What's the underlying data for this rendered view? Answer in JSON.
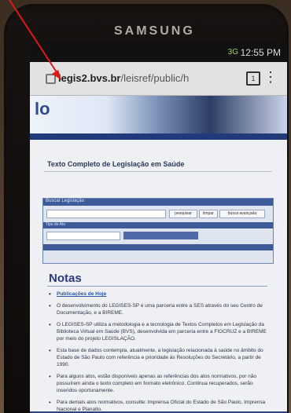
{
  "device": {
    "brand": "SAMSUNG"
  },
  "status_bar": {
    "signal": "3G",
    "time": "12:55 PM"
  },
  "browser": {
    "url_host": "legis2.bvs.br",
    "url_path": "/leisref/public/h",
    "tabs_count": "1"
  },
  "site": {
    "logo_text": "lo",
    "page_title": "Texto Completo de Legislação em Saúde"
  },
  "search": {
    "bar1": "Buscar Legislação",
    "buttons": [
      "pesquisar",
      "limpar",
      "busca avançada"
    ],
    "bar2": "Tipo de Ato",
    "bar3": ""
  },
  "notes": {
    "heading": "Notas",
    "items": [
      "Publicações de Hoje",
      "O desenvolvimento do LEGISES-SP é uma parceria entre a SES através do seu Centro de Documentação, e a BIREME.",
      "O LEGISES-SP utiliza a metodologia e a tecnologia de Textos Completos em Legislação da Biblioteca Virtual em Saúde (BVS), desenvolvida em parceria entre a FIOCRUZ e a BIREME por meio do projeto LEGISLAÇÃO.",
      "Esta base de dados contempla, atualmente, a legislação relacionada à saúde no âmbito do Estado de São Paulo com referência e prioridade às Resoluções do Secretário, a partir de 1990.",
      "Para alguns atos, estão disponíveis apenas as referências dos atos normativos, por não possuírem ainda o texto completo em formato eletrônico. Continua recuperados, serão inseridos oportunamente.",
      "Para demais atos normativos, consulte: Imprensa Oficial do Estado de São Paulo, Imprensa Nacional e Planalto."
    ]
  },
  "colors": {
    "annotation_arrow": "#e01818",
    "link": "#2a55a8",
    "heading": "#2a3a82"
  }
}
